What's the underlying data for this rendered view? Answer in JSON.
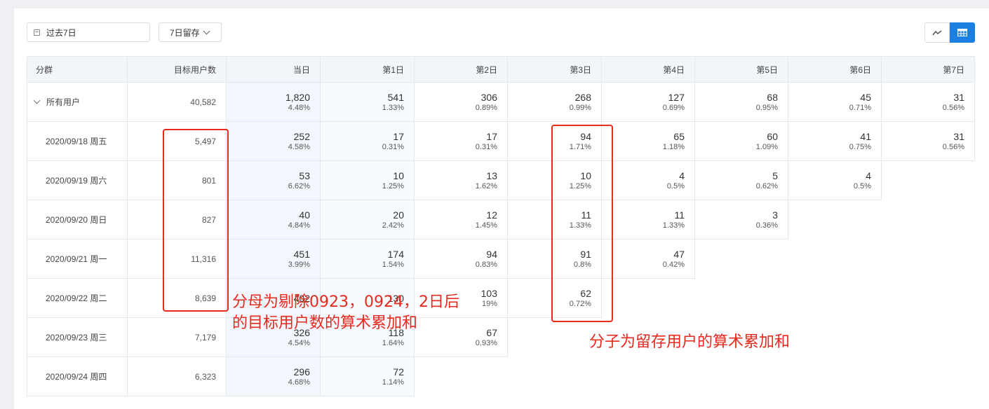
{
  "filters": {
    "date_range": "过去7日",
    "retention_type": "7日留存"
  },
  "view_toggle": {
    "line_icon": "trend-line-icon",
    "table_icon": "table-icon",
    "active": "table",
    "accent_color": "#1a7fe0"
  },
  "table": {
    "headers": [
      "分群",
      "目标用户数",
      "当日",
      "第1日",
      "第2日",
      "第3日",
      "第4日",
      "第5日",
      "第6日",
      "第7日"
    ],
    "rows": [
      {
        "group": "所有用户",
        "users": "40,582",
        "cells": [
          [
            "1,820",
            "4.48%"
          ],
          [
            "541",
            "1.33%"
          ],
          [
            "306",
            "0.89%"
          ],
          [
            "268",
            "0.99%"
          ],
          [
            "127",
            "0.69%"
          ],
          [
            "68",
            "0.95%"
          ],
          [
            "45",
            "0.71%"
          ],
          [
            "31",
            "0.56%"
          ]
        ]
      },
      {
        "group": "2020/09/18 周五",
        "users": "5,497",
        "cells": [
          [
            "252",
            "4.58%"
          ],
          [
            "17",
            "0.31%"
          ],
          [
            "17",
            "0.31%"
          ],
          [
            "94",
            "1.71%"
          ],
          [
            "65",
            "1.18%"
          ],
          [
            "60",
            "1.09%"
          ],
          [
            "41",
            "0.75%"
          ],
          [
            "31",
            "0.56%"
          ]
        ]
      },
      {
        "group": "2020/09/19 周六",
        "users": "801",
        "cells": [
          [
            "53",
            "6.62%"
          ],
          [
            "10",
            "1.25%"
          ],
          [
            "13",
            "1.62%"
          ],
          [
            "10",
            "1.25%"
          ],
          [
            "4",
            "0.5%"
          ],
          [
            "5",
            "0.62%"
          ],
          [
            "4",
            "0.5%"
          ]
        ]
      },
      {
        "group": "2020/09/20 周日",
        "users": "827",
        "cells": [
          [
            "40",
            "4.84%"
          ],
          [
            "20",
            "2.42%"
          ],
          [
            "12",
            "1.45%"
          ],
          [
            "11",
            "1.33%"
          ],
          [
            "11",
            "1.33%"
          ],
          [
            "3",
            "0.36%"
          ]
        ]
      },
      {
        "group": "2020/09/21 周一",
        "users": "11,316",
        "cells": [
          [
            "451",
            "3.99%"
          ],
          [
            "174",
            "1.54%"
          ],
          [
            "94",
            "0.83%"
          ],
          [
            "91",
            "0.8%"
          ],
          [
            "47",
            "0.42%"
          ]
        ]
      },
      {
        "group": "2020/09/22 周二",
        "users": "8,639",
        "cells": [
          [
            "402",
            ""
          ],
          [
            "130",
            ""
          ],
          [
            "103",
            "19%"
          ],
          [
            "62",
            "0.72%"
          ]
        ]
      },
      {
        "group": "2020/09/23 周三",
        "users": "7,179",
        "cells": [
          [
            "326",
            "4.54%"
          ],
          [
            "118",
            "1.64%"
          ],
          [
            "67",
            "0.93%"
          ]
        ]
      },
      {
        "group": "2020/09/24 周四",
        "users": "6,323",
        "cells": [
          [
            "296",
            "4.68%"
          ],
          [
            "72",
            "1.14%"
          ]
        ]
      }
    ]
  },
  "annotations": {
    "left_line1": "分母为剔除0923，0924，2日后",
    "left_line2": "的目标用户数的算术累加和",
    "right": "分子为留存用户的算术累加和",
    "color": "#e62a1e"
  }
}
